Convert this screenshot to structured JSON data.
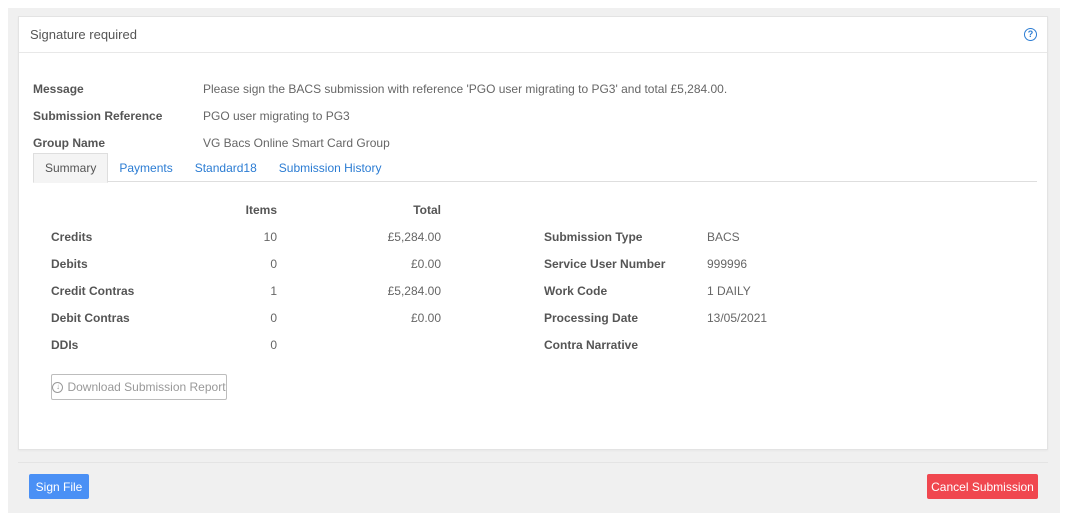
{
  "panel": {
    "title": "Signature required",
    "help_icon": "question-circle-icon"
  },
  "info": [
    {
      "label": "Message",
      "value": "Please sign the BACS submission with reference 'PGO user migrating to PG3' and total £5,284.00."
    },
    {
      "label": "Submission Reference",
      "value": "PGO user migrating to PG3"
    },
    {
      "label": "Group Name",
      "value": "VG Bacs Online Smart Card Group"
    }
  ],
  "tabs": [
    {
      "label": "Summary",
      "active": true
    },
    {
      "label": "Payments",
      "active": false
    },
    {
      "label": "Standard18",
      "active": false
    },
    {
      "label": "Submission History",
      "active": false
    }
  ],
  "summary": {
    "headers": {
      "items": "Items",
      "total": "Total"
    },
    "rows": [
      {
        "label": "Credits",
        "items": "10",
        "total": "£5,284.00"
      },
      {
        "label": "Debits",
        "items": "0",
        "total": "£0.00"
      },
      {
        "label": "Credit Contras",
        "items": "1",
        "total": "£5,284.00"
      },
      {
        "label": "Debit Contras",
        "items": "0",
        "total": "£0.00"
      },
      {
        "label": "DDIs",
        "items": "0",
        "total": ""
      }
    ],
    "details": [
      {
        "label": "Submission Type",
        "value": "BACS"
      },
      {
        "label": "Service User Number",
        "value": "999996"
      },
      {
        "label": "Work Code",
        "value": "1 DAILY"
      },
      {
        "label": "Processing Date",
        "value": "13/05/2021"
      },
      {
        "label": "Contra Narrative",
        "value": ""
      }
    ],
    "download_label": "Download Submission Report",
    "download_icon": "download-circle-icon"
  },
  "footer": {
    "sign_label": "Sign File",
    "cancel_label": "Cancel Submission"
  },
  "colors": {
    "link": "#2b7cd3",
    "primary": "#4a90f5",
    "danger": "#f0474f"
  }
}
